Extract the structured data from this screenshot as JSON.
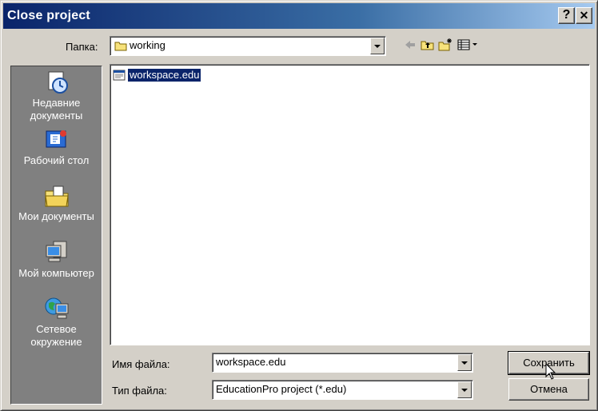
{
  "window": {
    "title": "Close project"
  },
  "titlebar": {
    "help_label": "?",
    "close_label": "✕"
  },
  "lookin": {
    "label": "Папка:",
    "value": "working",
    "icon": "folder-icon"
  },
  "toolbar": {
    "icons": [
      "back-arrow-icon",
      "up-one-level-icon",
      "new-folder-icon",
      "view-menu-icon"
    ]
  },
  "places": [
    {
      "label": "Недавние документы",
      "icon": "recent-documents-icon"
    },
    {
      "label": "Рабочий стол",
      "icon": "desktop-icon"
    },
    {
      "label": "Мои документы",
      "icon": "my-documents-icon"
    },
    {
      "label": "Мой компьютер",
      "icon": "my-computer-icon"
    },
    {
      "label": "Сетевое окружение",
      "icon": "network-places-icon"
    }
  ],
  "files": [
    {
      "name": "workspace.edu",
      "icon": "edu-file-icon",
      "selected": true
    }
  ],
  "filename": {
    "label": "Имя файла:",
    "value": "workspace.edu"
  },
  "filetype": {
    "label": "Тип файла:",
    "value": "EducationPro project (*.edu)"
  },
  "buttons": {
    "save": "Сохранить",
    "cancel": "Отмена"
  }
}
